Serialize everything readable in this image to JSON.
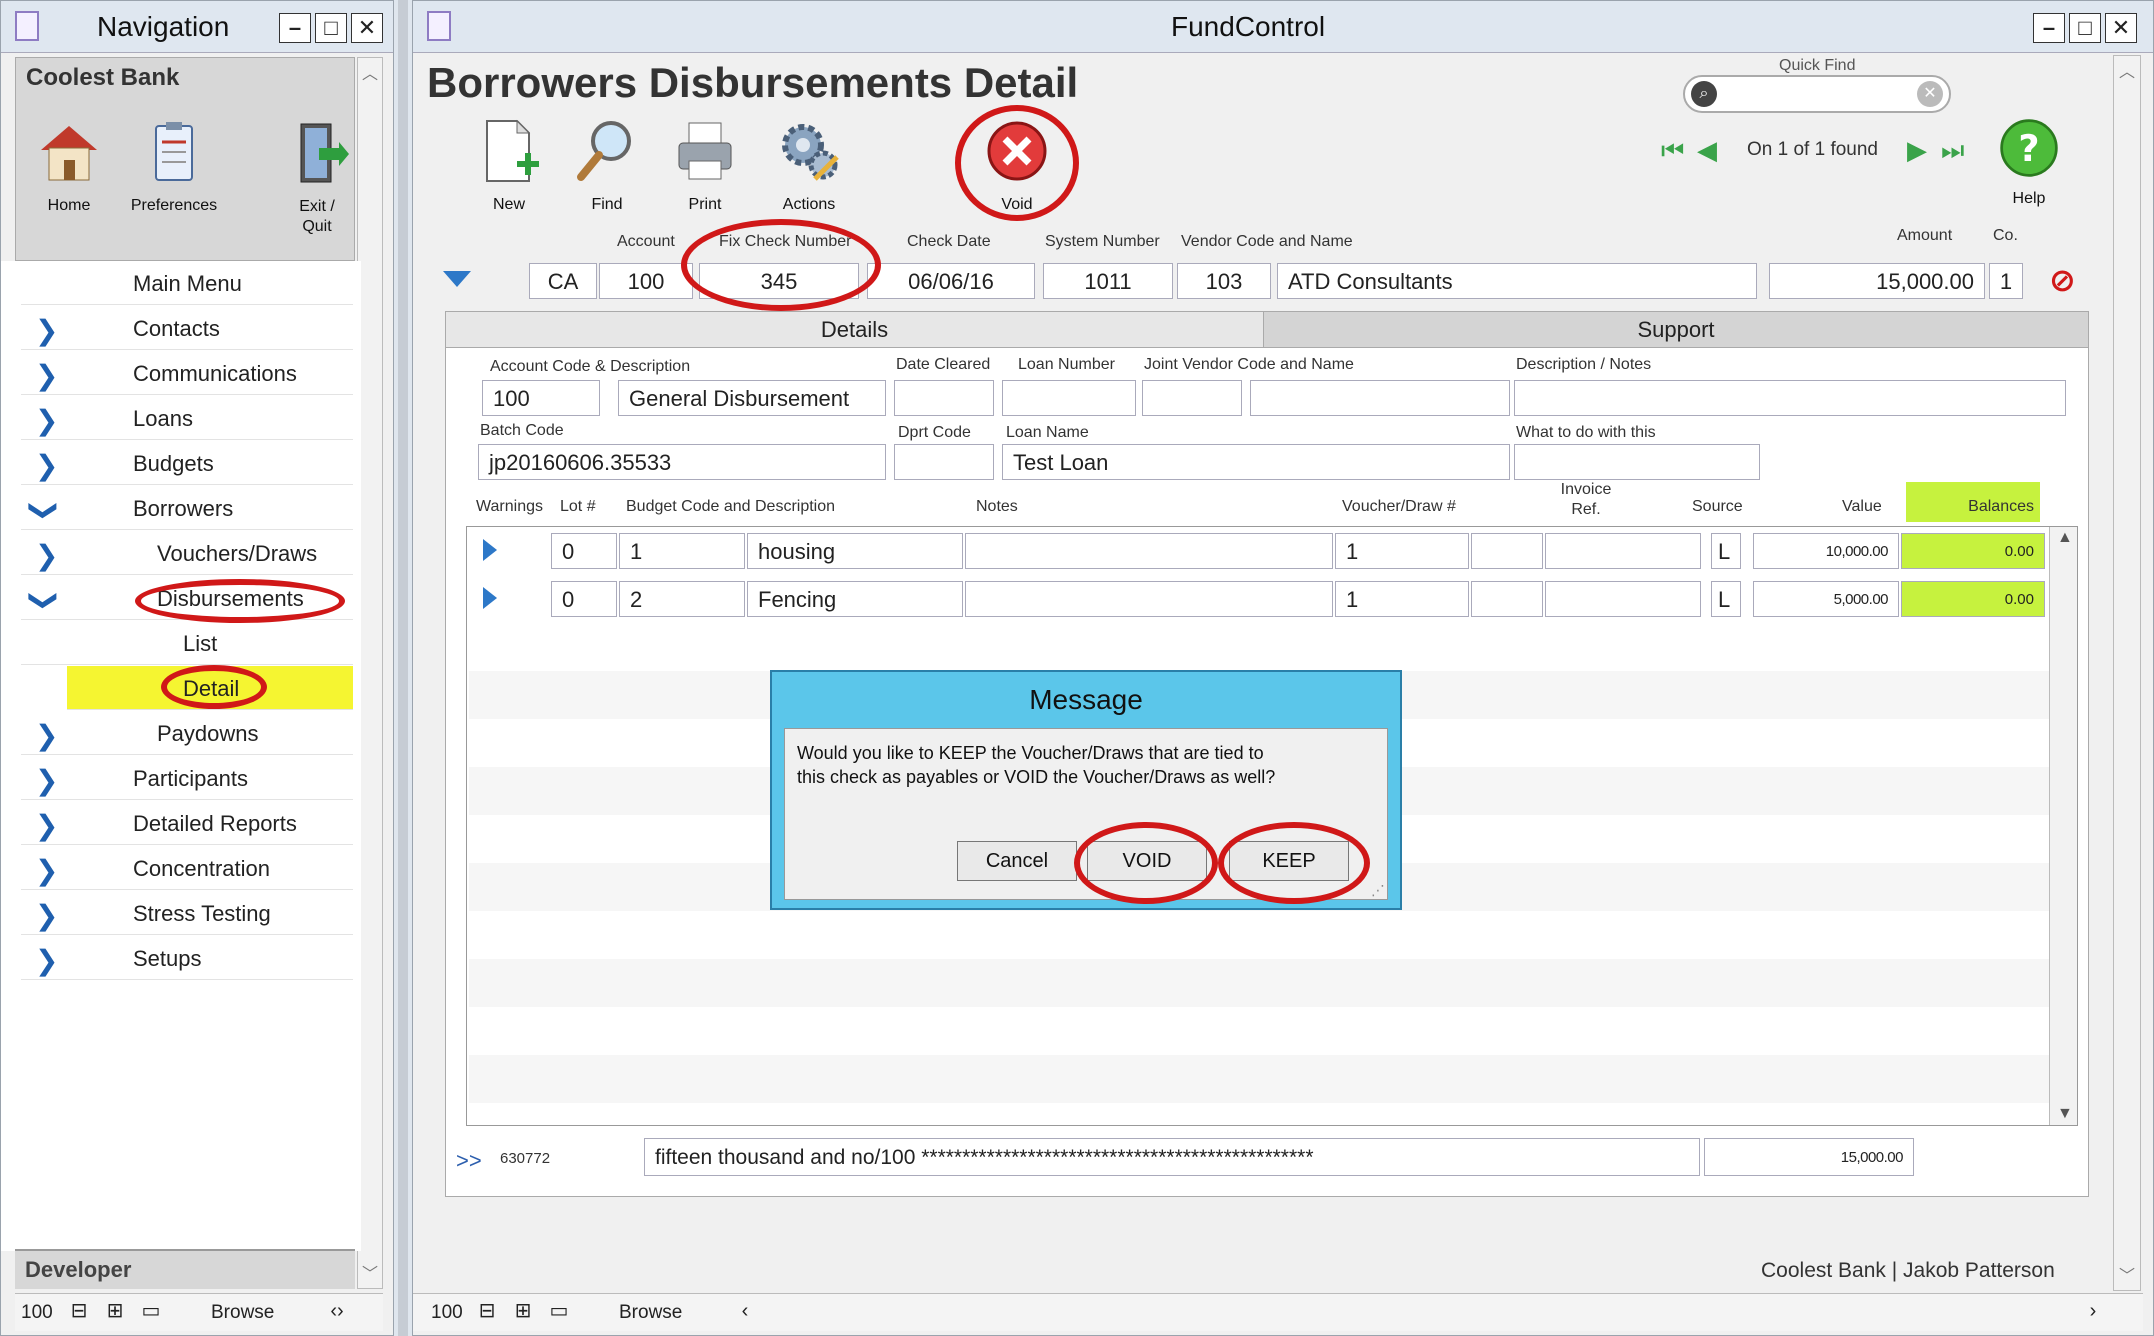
{
  "nav_window": {
    "title": "Navigation",
    "bank_name": "Coolest Bank",
    "toolbar": [
      {
        "label": "Home",
        "icon": "house-icon"
      },
      {
        "label": "Preferences",
        "icon": "clipboard-icon"
      },
      {
        "label": "Exit / Quit",
        "icon": "exit-door-icon"
      }
    ],
    "menu": [
      {
        "label": "Main Menu"
      },
      {
        "label": "Contacts"
      },
      {
        "label": "Communications"
      },
      {
        "label": "Loans"
      },
      {
        "label": "Budgets"
      },
      {
        "label": "Borrowers"
      },
      {
        "label": "Vouchers/Draws"
      },
      {
        "label": "Disbursements"
      },
      {
        "label": "List"
      },
      {
        "label": "Detail"
      },
      {
        "label": "Paydowns"
      },
      {
        "label": "Participants"
      },
      {
        "label": "Detailed Reports"
      },
      {
        "label": "Concentration"
      },
      {
        "label": "Stress Testing"
      },
      {
        "label": "Setups"
      }
    ],
    "footer_label": "Developer",
    "status": {
      "zoom": "100",
      "mode": "Browse"
    }
  },
  "main_window": {
    "title": "FundControl",
    "page_title": "Borrowers Disbursements Detail",
    "toolbar": [
      {
        "label": "New",
        "icon": "new-document-icon"
      },
      {
        "label": "Find",
        "icon": "magnifier-icon"
      },
      {
        "label": "Print",
        "icon": "printer-icon"
      },
      {
        "label": "Actions",
        "icon": "gears-icon"
      },
      {
        "label": "Void",
        "icon": "void-x-icon"
      }
    ],
    "quick_find": {
      "label": "Quick Find",
      "value": ""
    },
    "record_nav": {
      "text": "On 1 of 1 found"
    },
    "help_label": "Help",
    "header_labels": {
      "account": "Account",
      "check_number": "Fix Check Number",
      "check_date": "Check Date",
      "system_number": "System Number",
      "vendor": "Vendor Code and Name",
      "amount": "Amount",
      "co": "Co."
    },
    "header_values": {
      "type": "CA",
      "account": "100",
      "check_number": "345",
      "check_date": "06/06/16",
      "system_number": "1011",
      "vendor_code": "103",
      "vendor_name": "ATD Consultants",
      "amount": "15,000.00",
      "co": "1"
    },
    "tabs": [
      {
        "label": "Details"
      },
      {
        "label": "Support"
      }
    ],
    "details": {
      "labels": {
        "account_code": "Account Code & Description",
        "date_cleared": "Date Cleared",
        "loan_number": "Loan Number",
        "joint_vendor": "Joint Vendor Code and Name",
        "description_notes": "Description / Notes",
        "batch_code": "Batch Code",
        "dprt_code": "Dprt Code",
        "loan_name": "Loan Name",
        "what_to_do": "What to do with this"
      },
      "values": {
        "account_code": "100",
        "account_desc": "General Disbursement",
        "batch_code": "jp20160606.35533",
        "loan_name": "Test Loan"
      }
    },
    "line_headers": {
      "warnings": "Warnings",
      "lot": "Lot #",
      "budget": "Budget Code and Description",
      "notes": "Notes",
      "voucher": "Voucher/Draw #",
      "invoice": "Invoice Ref.",
      "source": "Source",
      "value": "Value",
      "balances": "Balances"
    },
    "lines": [
      {
        "lot": "0",
        "budget_code": "1",
        "budget_desc": "housing",
        "voucher": "1",
        "source": "L",
        "value": "10,000.00",
        "balance": "0.00"
      },
      {
        "lot": "0",
        "budget_code": "2",
        "budget_desc": "Fencing",
        "voucher": "1",
        "source": "L",
        "value": "5,000.00",
        "balance": "0.00"
      }
    ],
    "footer": {
      "arrows": ">>",
      "code": "630772",
      "amount_words": "fifteen thousand and no/100 ************************************************",
      "total": "15,000.00"
    },
    "user_line": "Coolest Bank | Jakob Patterson",
    "status": {
      "zoom": "100",
      "mode": "Browse"
    }
  },
  "dialog": {
    "title": "Message",
    "text_line1": "Would you like to KEEP the Voucher/Draws that are tied to",
    "text_line2": "this check as payables or VOID the Voucher/Draws as well?",
    "buttons": {
      "cancel": "Cancel",
      "void": "VOID",
      "keep": "KEEP"
    }
  },
  "colors": {
    "highlight_yellow": "#f5f531",
    "balance_green": "#c6f23e",
    "dialog_blue": "#5bc6ea",
    "annotation_red": "#d01818",
    "chevron_blue": "#1f5fae"
  }
}
